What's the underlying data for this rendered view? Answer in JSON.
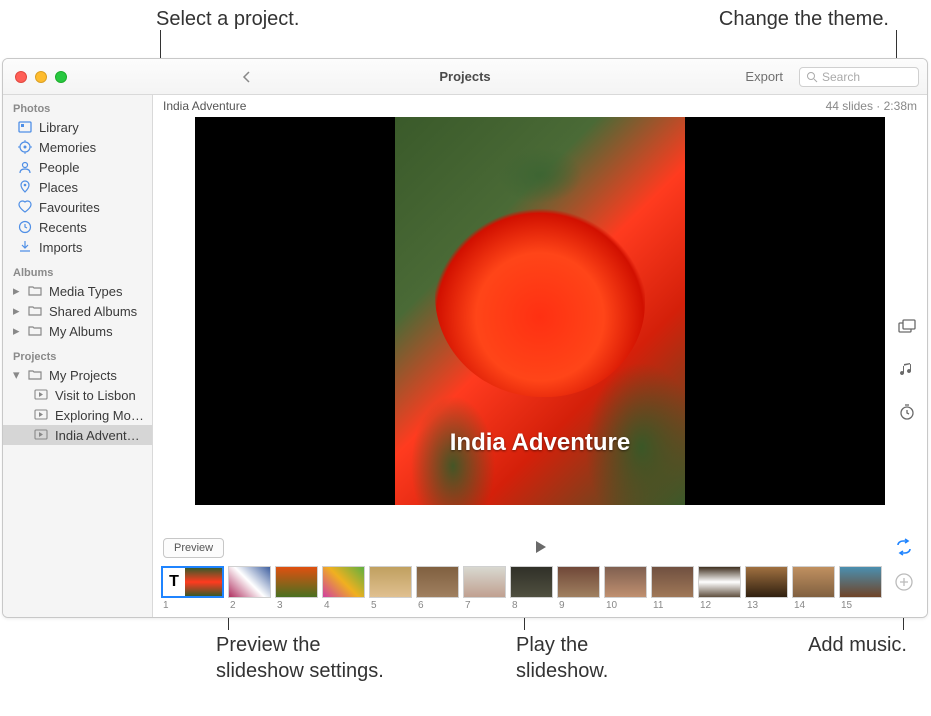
{
  "callouts": {
    "select_project": "Select a project.",
    "change_theme": "Change the theme.",
    "preview_settings_l1": "Preview the",
    "preview_settings_l2": "slideshow settings.",
    "play_l1": "Play the",
    "play_l2": "slideshow.",
    "add_music": "Add music."
  },
  "titlebar": {
    "title": "Projects",
    "export_label": "Export",
    "search_placeholder": "Search"
  },
  "sidebar": {
    "sections": {
      "photos_header": "Photos",
      "albums_header": "Albums",
      "projects_header": "Projects"
    },
    "photos": {
      "library": "Library",
      "memories": "Memories",
      "people": "People",
      "places": "Places",
      "favourites": "Favourites",
      "recents": "Recents",
      "imports": "Imports"
    },
    "albums": {
      "media_types": "Media Types",
      "shared_albums": "Shared Albums",
      "my_albums": "My Albums"
    },
    "projects": {
      "my_projects": "My Projects",
      "items": {
        "0": "Visit to Lisbon",
        "1": "Exploring Mor…",
        "2": "India Adventure"
      }
    }
  },
  "main": {
    "project_title": "India Adventure",
    "slides_info": "44 slides · 2:38m",
    "slide_overlay_title": "India Adventure",
    "preview_button": "Preview",
    "title_slide_letter": "T",
    "thumbs": [
      "1",
      "2",
      "3",
      "4",
      "5",
      "6",
      "7",
      "8",
      "9",
      "10",
      "11",
      "12",
      "13",
      "14",
      "15"
    ]
  }
}
